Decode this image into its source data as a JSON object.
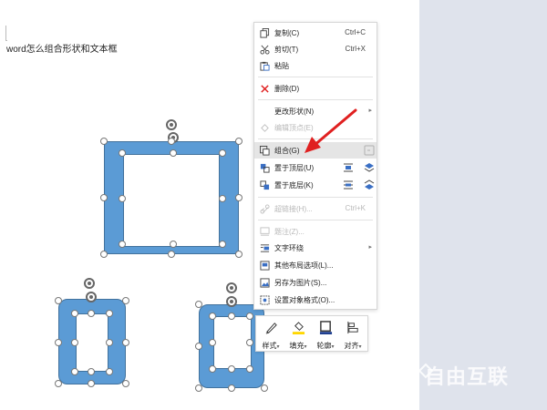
{
  "document": {
    "text": "word怎么组合形状和文本框"
  },
  "context_menu": {
    "items": [
      {
        "label": "复制(C)",
        "shortcut": "Ctrl+C",
        "icon": "copy-icon"
      },
      {
        "label": "剪切(T)",
        "shortcut": "Ctrl+X",
        "icon": "scissors-icon"
      },
      {
        "label": "粘贴",
        "icon": "paste-icon"
      },
      {
        "label": "删除(D)",
        "icon": "delete-x-icon"
      },
      {
        "label": "更改形状(N)",
        "icon": "change-shape-icon",
        "submenu": true
      },
      {
        "label": "编辑顶点(E)",
        "icon": "edit-points-icon",
        "disabled": true
      },
      {
        "label": "组合(G)",
        "icon": "group-icon",
        "highlighted": true
      },
      {
        "label": "置于顶层(U)",
        "icon": "bring-to-front-icon",
        "submenu": true
      },
      {
        "label": "置于底层(K)",
        "icon": "send-to-back-icon",
        "submenu": true
      },
      {
        "label": "超链接(H)...",
        "shortcut": "Ctrl+K",
        "icon": "hyperlink-icon",
        "disabled": true
      },
      {
        "label": "题注(Z)...",
        "icon": "caption-icon",
        "disabled": true
      },
      {
        "label": "文字环绕",
        "icon": "text-wrap-icon",
        "submenu": true
      },
      {
        "label": "其他布局选项(L)...",
        "icon": "layout-options-icon"
      },
      {
        "label": "另存为图片(S)...",
        "icon": "save-as-picture-icon"
      },
      {
        "label": "设置对象格式(O)...",
        "icon": "format-object-icon"
      }
    ],
    "submenu_arrow": "▸"
  },
  "mini_toolbar": {
    "buttons": [
      {
        "label": "样式",
        "icon": "style-pen-icon",
        "dropdown": "▾"
      },
      {
        "label": "填充",
        "icon": "fill-bucket-icon",
        "dropdown": "▾"
      },
      {
        "label": "轮廓",
        "icon": "outline-icon",
        "dropdown": "▾"
      },
      {
        "label": "对齐",
        "icon": "align-icon",
        "dropdown": "▾"
      }
    ]
  },
  "watermark": {
    "text": "自由互联"
  },
  "colors": {
    "shape_fill": "#5b9bd5",
    "shape_border": "#41719c",
    "annotation_arrow": "#e02020",
    "side_panel": "#dfe3ec",
    "highlight": "#e5e5e5"
  }
}
